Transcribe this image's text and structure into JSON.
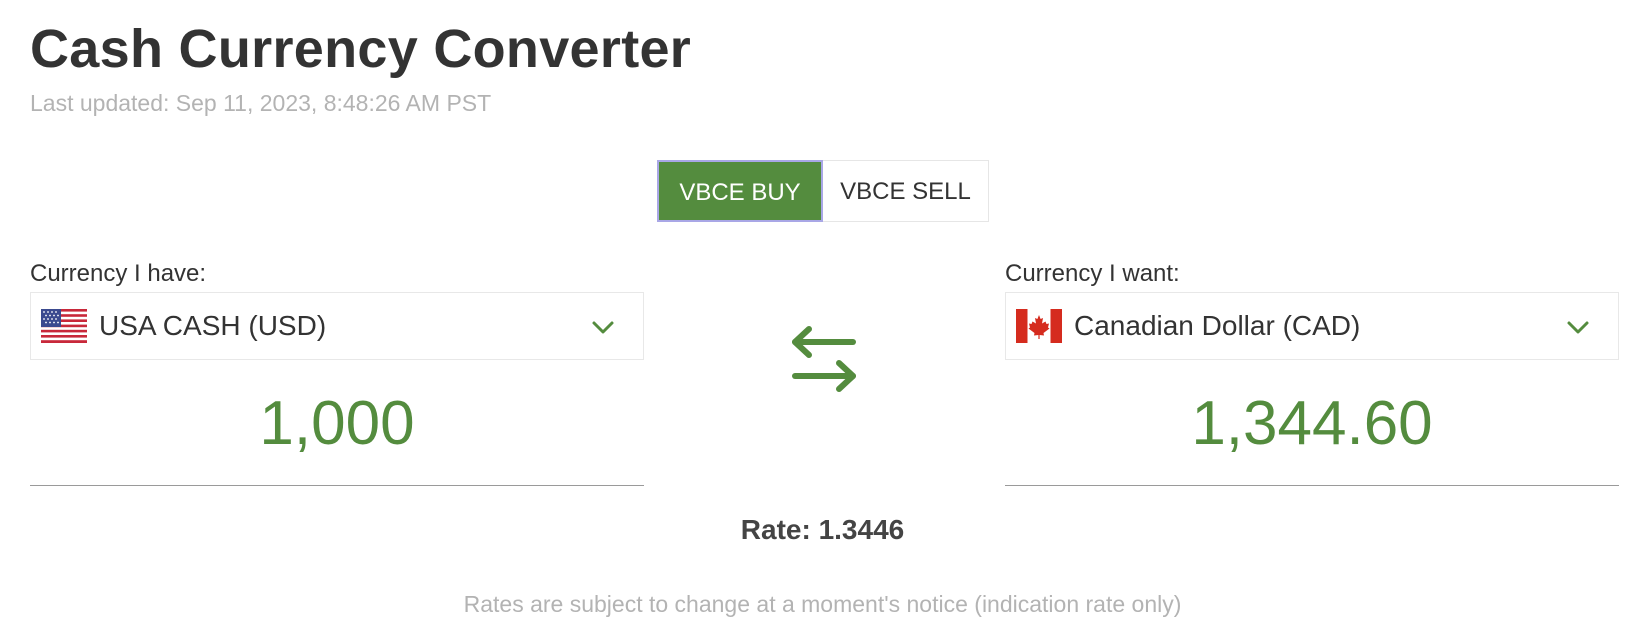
{
  "header": {
    "title": "Cash Currency Converter",
    "last_updated": "Last updated: Sep 11, 2023, 8:48:26 AM PST"
  },
  "toggle": {
    "buy_label": "VBCE BUY",
    "sell_label": "VBCE SELL",
    "selected": "VBCE BUY"
  },
  "have": {
    "label": "Currency I have:",
    "currency": "USA CASH (USD)",
    "flag_icon": "us-flag-icon",
    "amount": "1,000"
  },
  "want": {
    "label": "Currency I want:",
    "currency": "Canadian Dollar (CAD)",
    "flag_icon": "canada-flag-icon",
    "amount": "1,344.60"
  },
  "rate": {
    "text": "Rate: 1.3446"
  },
  "footer": {
    "notice": "Rates are subject to change at a moment's notice (indication rate only)"
  },
  "colors": {
    "accent": "#548c3e",
    "muted_text": "#b3b3b3",
    "focus_border": "#a9a7e6"
  }
}
